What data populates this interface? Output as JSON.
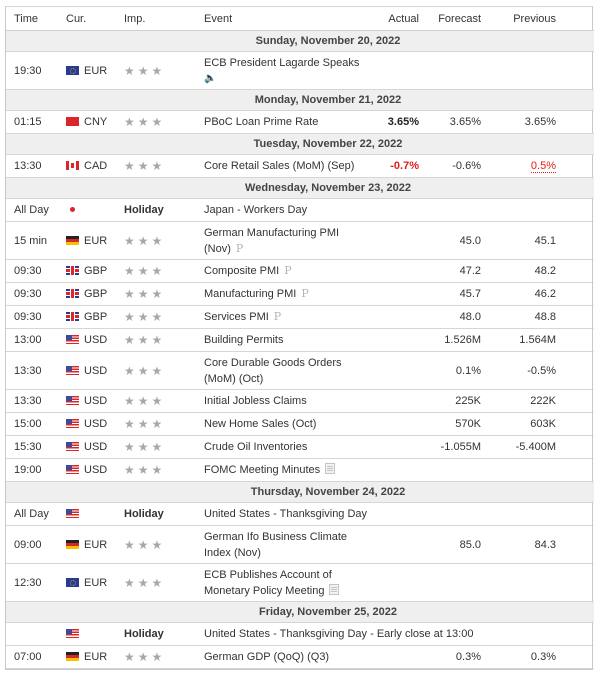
{
  "header": {
    "time": "Time",
    "currency": "Cur.",
    "importance": "Imp.",
    "event": "Event",
    "actual": "Actual",
    "forecast": "Forecast",
    "previous": "Previous"
  },
  "colors": {
    "negative": "#e21b1b",
    "day_row_bg": "#efefef",
    "star": "#a8a8a8"
  },
  "rows": [
    {
      "type": "day",
      "label": "Sunday, November 20, 2022"
    },
    {
      "type": "event",
      "time": "19:30",
      "flag": "eu",
      "currency": "EUR",
      "importance": "★★★",
      "event": "ECB President Lagarde Speaks",
      "event_icon": "speaker-icon",
      "actual": "",
      "forecast": "",
      "previous": ""
    },
    {
      "type": "day",
      "label": "Monday, November 21, 2022"
    },
    {
      "type": "event",
      "time": "01:15",
      "flag": "cn",
      "currency": "CNY",
      "importance": "★★★",
      "event": "PBoC Loan Prime Rate",
      "actual": "3.65%",
      "forecast": "3.65%",
      "previous": "3.65%"
    },
    {
      "type": "day",
      "label": "Tuesday, November 22, 2022"
    },
    {
      "type": "event",
      "time": "13:30",
      "flag": "ca",
      "currency": "CAD",
      "importance": "★★★",
      "event": "Core Retail Sales (MoM) (Sep)",
      "actual": "-0.7%",
      "forecast": "-0.6%",
      "previous": "0.5%"
    },
    {
      "type": "day",
      "label": "Wednesday, November 23, 2022"
    },
    {
      "type": "holiday",
      "time": "All Day",
      "flag": "jp",
      "importance": "Holiday",
      "event": "Japan - Workers Day"
    },
    {
      "type": "event",
      "time": "15 min",
      "flag": "de",
      "currency": "EUR",
      "importance": "★★★",
      "event": "German Manufacturing PMI (Nov)",
      "event_icon": "preliminary-icon",
      "actual": "",
      "forecast": "45.0",
      "previous": "45.1"
    },
    {
      "type": "event",
      "time": "09:30",
      "flag": "gb",
      "currency": "GBP",
      "importance": "★★★",
      "event": "Composite PMI",
      "event_icon": "preliminary-icon",
      "actual": "",
      "forecast": "47.2",
      "previous": "48.2"
    },
    {
      "type": "event",
      "time": "09:30",
      "flag": "gb",
      "currency": "GBP",
      "importance": "★★★",
      "event": "Manufacturing PMI",
      "event_icon": "preliminary-icon",
      "actual": "",
      "forecast": "45.7",
      "previous": "46.2"
    },
    {
      "type": "event",
      "time": "09:30",
      "flag": "gb",
      "currency": "GBP",
      "importance": "★★★",
      "event": "Services PMI",
      "event_icon": "preliminary-icon",
      "actual": "",
      "forecast": "48.0",
      "previous": "48.8"
    },
    {
      "type": "event",
      "time": "13:00",
      "flag": "us",
      "currency": "USD",
      "importance": "★★★",
      "event": "Building Permits",
      "actual": "",
      "forecast": "1.526M",
      "previous": "1.564M"
    },
    {
      "type": "event",
      "time": "13:30",
      "flag": "us",
      "currency": "USD",
      "importance": "★★★",
      "event": "Core Durable Goods Orders (MoM) (Oct)",
      "actual": "",
      "forecast": "0.1%",
      "previous": "-0.5%"
    },
    {
      "type": "event",
      "time": "13:30",
      "flag": "us",
      "currency": "USD",
      "importance": "★★★",
      "event": "Initial Jobless Claims",
      "actual": "",
      "forecast": "225K",
      "previous": "222K"
    },
    {
      "type": "event",
      "time": "15:00",
      "flag": "us",
      "currency": "USD",
      "importance": "★★★",
      "event": "New Home Sales (Oct)",
      "actual": "",
      "forecast": "570K",
      "previous": "603K"
    },
    {
      "type": "event",
      "time": "15:30",
      "flag": "us",
      "currency": "USD",
      "importance": "★★★",
      "event": "Crude Oil Inventories",
      "actual": "",
      "forecast": "-1.055M",
      "previous": "-5.400M"
    },
    {
      "type": "event",
      "time": "19:00",
      "flag": "us",
      "currency": "USD",
      "importance": "★★★",
      "event": "FOMC Meeting Minutes",
      "event_icon": "document-icon",
      "actual": "",
      "forecast": "",
      "previous": ""
    },
    {
      "type": "day",
      "label": "Thursday, November 24, 2022"
    },
    {
      "type": "holiday",
      "time": "All Day",
      "flag": "us",
      "importance": "Holiday",
      "event": "United States - Thanksgiving Day"
    },
    {
      "type": "event",
      "time": "09:00",
      "flag": "de",
      "currency": "EUR",
      "importance": "★★★",
      "event": "German Ifo Business Climate Index (Nov)",
      "actual": "",
      "forecast": "85.0",
      "previous": "84.3"
    },
    {
      "type": "event",
      "time": "12:30",
      "flag": "eu",
      "currency": "EUR",
      "importance": "★★★",
      "event": "ECB Publishes Account of Monetary Policy Meeting",
      "event_icon": "document-icon",
      "actual": "",
      "forecast": "",
      "previous": ""
    },
    {
      "type": "day",
      "label": "Friday, November 25, 2022"
    },
    {
      "type": "holiday",
      "time": "",
      "flag": "us",
      "importance": "Holiday",
      "event": "United States - Thanksgiving Day - Early close at 13:00"
    },
    {
      "type": "event",
      "time": "07:00",
      "flag": "de",
      "currency": "EUR",
      "importance": "★★★",
      "event": "German GDP (QoQ) (Q3)",
      "actual": "",
      "forecast": "0.3%",
      "previous": "0.3%"
    }
  ]
}
